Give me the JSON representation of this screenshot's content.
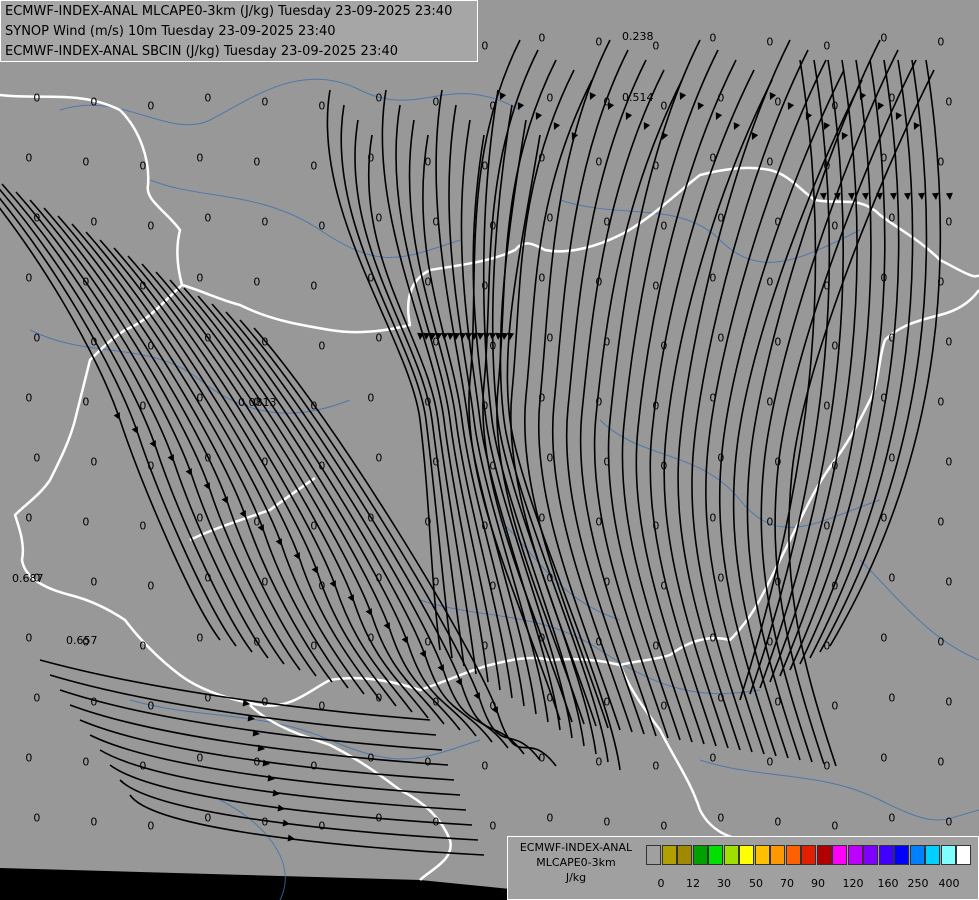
{
  "header": {
    "line1": "ECMWF-INDEX-ANAL MLCAPE0-3km (J/kg) Tuesday 23-09-2025 23:40",
    "line2": "SYNOP Wind (m/s) 10m Tuesday 23-09-2025 23:40",
    "line3": "ECMWF-INDEX-ANAL SBCIN (J/kg) Tuesday 23-09-2025 23:40"
  },
  "legend": {
    "title1": "ECMWF-INDEX-ANAL",
    "title2": "MLCAPE0-3km",
    "unit": "J/kg",
    "colors": [
      "#a0a0a0",
      "#b0a000",
      "#a08800",
      "#00a000",
      "#00e000",
      "#a0e000",
      "#ffff00",
      "#ffc000",
      "#ff9800",
      "#ff6000",
      "#e02000",
      "#b00000",
      "#ff00ff",
      "#c000ff",
      "#8000ff",
      "#4000ff",
      "#0000ff",
      "#0080ff",
      "#00d0ff",
      "#80ffff",
      "#ffffff"
    ],
    "ticks": [
      "0",
      "12",
      "30",
      "50",
      "70",
      "90",
      "120",
      "160",
      "250",
      "400"
    ]
  },
  "map_labels": {
    "zero": "0",
    "special": [
      "0.238",
      "0.514",
      "0.0813",
      "0.687",
      "0.657"
    ]
  }
}
